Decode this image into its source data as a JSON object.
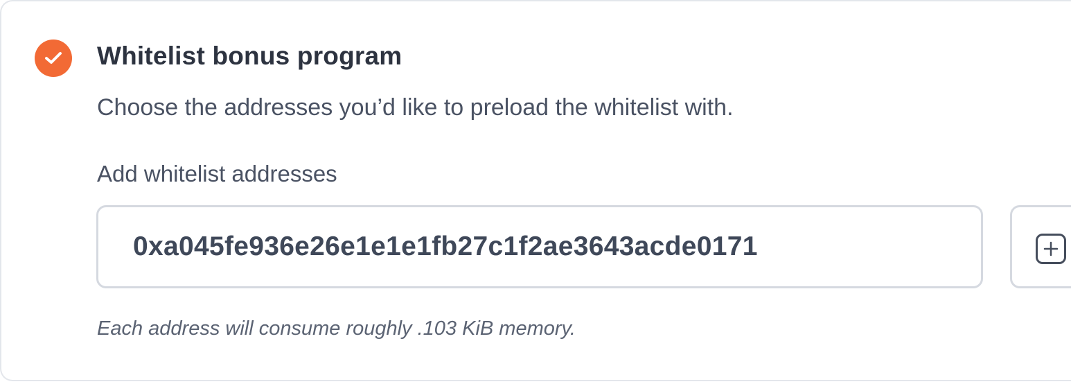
{
  "section": {
    "title": "Whitelist bonus program",
    "description": "Choose the addresses you’d like to preload the whitelist with.",
    "status_icon": "check-circle-icon",
    "accent_color": "#f26a35"
  },
  "address_field": {
    "label": "Add whitelist addresses",
    "value": "0xa045fe936e26e1e1e1fb27c1f2ae3643acde0171"
  },
  "add_button": {
    "icon": "plus-square-icon"
  },
  "hint": "Each address will consume roughly .103 KiB memory."
}
